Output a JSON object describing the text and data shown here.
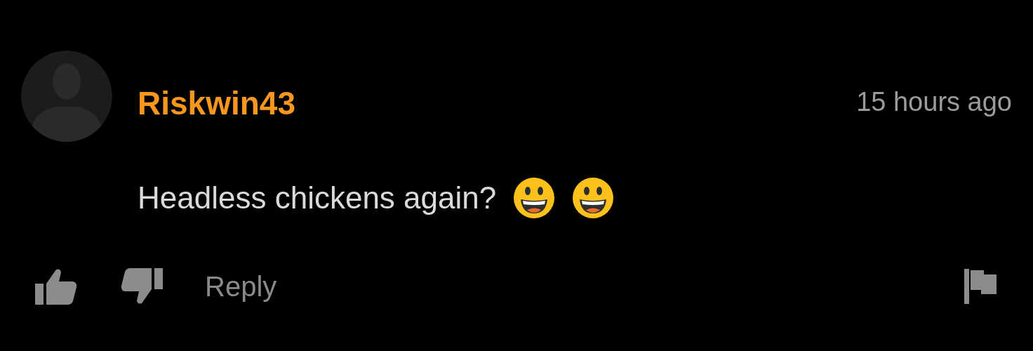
{
  "comment": {
    "username": "Riskwin43",
    "time": "15 hours ago",
    "text": "Headless chickens again?",
    "reactions": [
      {
        "kind": "grinning"
      },
      {
        "kind": "grinning"
      }
    ]
  },
  "actions": {
    "reply": "Reply"
  }
}
